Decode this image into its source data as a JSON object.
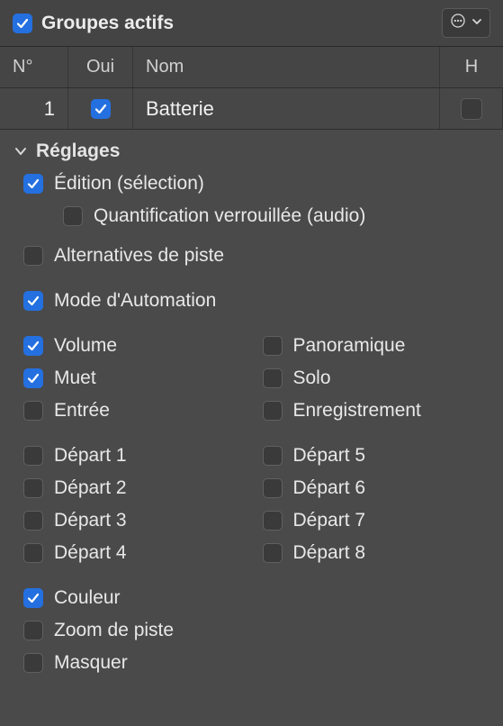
{
  "header": {
    "title": "Groupes actifs",
    "checked": true
  },
  "columns": {
    "no": "N°",
    "oui": "Oui",
    "nom": "Nom",
    "h": "H"
  },
  "row": {
    "no": "1",
    "nom": "Batterie"
  },
  "settings": {
    "title": "Réglages",
    "edition": "Édition (sélection)",
    "quantification": "Quantification verrouillée (audio)",
    "alternatives": "Alternatives de piste",
    "automation": "Mode d'Automation",
    "volume": "Volume",
    "muet": "Muet",
    "entree": "Entrée",
    "panoramique": "Panoramique",
    "solo": "Solo",
    "enregistrement": "Enregistrement",
    "depart1": "Départ 1",
    "depart2": "Départ 2",
    "depart3": "Départ 3",
    "depart4": "Départ 4",
    "depart5": "Départ 5",
    "depart6": "Départ 6",
    "depart7": "Départ 7",
    "depart8": "Départ 8",
    "couleur": "Couleur",
    "zoom": "Zoom de piste",
    "masquer": "Masquer"
  }
}
